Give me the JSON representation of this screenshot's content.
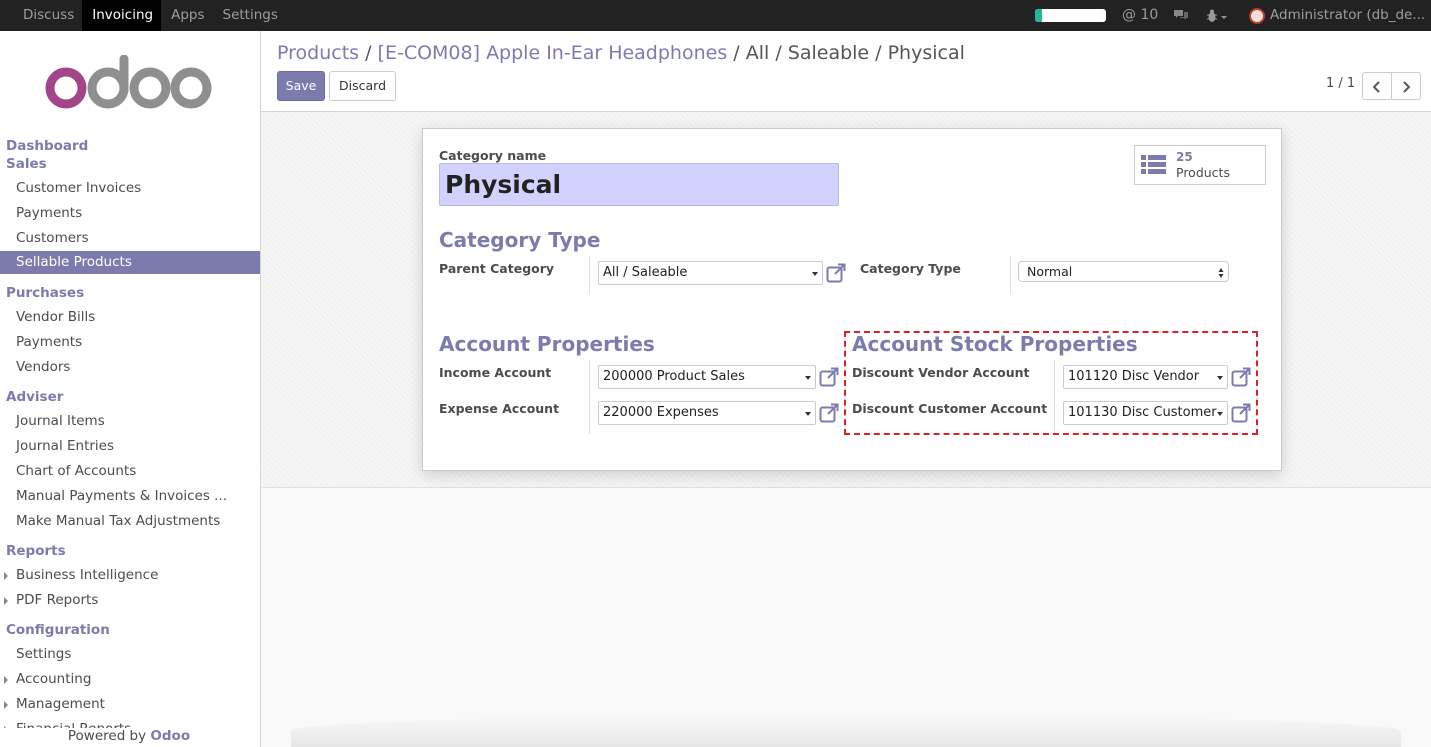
{
  "topbar": {
    "menu": [
      "Discuss",
      "Invoicing",
      "Apps",
      "Settings"
    ],
    "active_menu": "Invoicing",
    "progress_fraction": 0.1,
    "mentions": "@ 10",
    "user": "Administrator (db_de..."
  },
  "sidebar": {
    "logo_text": "odoo",
    "sections": {
      "dashboard": "Dashboard",
      "sales": "Sales",
      "purchases": "Purchases",
      "adviser": "Adviser",
      "reports": "Reports",
      "configuration": "Configuration"
    },
    "sales_items": [
      "Customer Invoices",
      "Payments",
      "Customers",
      "Sellable Products"
    ],
    "purchases_items": [
      "Vendor Bills",
      "Payments",
      "Vendors"
    ],
    "adviser_items": [
      "Journal Items",
      "Journal Entries",
      "Chart of Accounts",
      "Manual Payments & Invoices ...",
      "Make Manual Tax Adjustments"
    ],
    "reports_items": [
      "Business Intelligence",
      "PDF Reports"
    ],
    "configuration_items": [
      "Settings",
      "Accounting",
      "Management",
      "Financial Reports"
    ],
    "active_item": "Sellable Products",
    "powered_prefix": "Powered by",
    "powered_brand": "Odoo"
  },
  "control_panel": {
    "breadcrumb": {
      "products": "Products",
      "product": "[E-COM08] Apple In-Ear Headphones",
      "current": "All / Saleable / Physical",
      "sep": "/"
    },
    "save_label": "Save",
    "discard_label": "Discard",
    "pager": "1 / 1"
  },
  "form": {
    "category_name_label": "Category name",
    "category_name_value": "Physical",
    "smart_button": {
      "value": "25",
      "label": "Products",
      "icon": "list-icon"
    },
    "category_type_title": "Category Type",
    "parent_category_label": "Parent Category",
    "parent_category_value": "All / Saleable",
    "category_type_label": "Category Type",
    "category_type_value": "Normal",
    "account_properties_title": "Account Properties",
    "income_account_label": "Income Account",
    "income_account_value": "200000 Product Sales",
    "expense_account_label": "Expense Account",
    "expense_account_value": "220000 Expenses",
    "account_stock_title": "Account Stock Properties",
    "discount_vendor_label": "Discount Vendor Account",
    "discount_vendor_value": "101120 Disc Vendor",
    "discount_customer_label": "Discount Customer Account",
    "discount_customer_value": "101130 Disc Customer"
  },
  "colors": {
    "brand": "#7c7bad",
    "topbar": "#222222",
    "highlight_border": "#e02020",
    "input_required_bg": "#d2d2ff",
    "progress": "#21b799"
  }
}
